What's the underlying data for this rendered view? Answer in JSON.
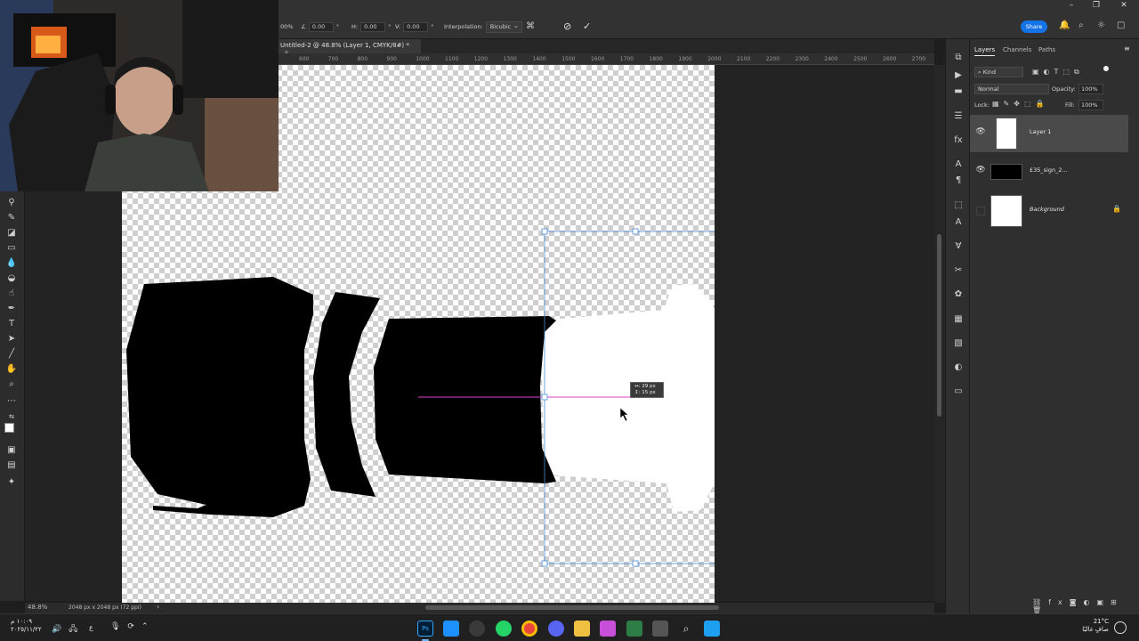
{
  "options_bar": {
    "zoom_fragment": "00%",
    "angle_value": "0.00",
    "angle_unit": "°",
    "h_label": "H:",
    "h_value": "0.00",
    "h_unit": "°",
    "v_label": "V:",
    "v_value": "0.00",
    "v_unit": "°",
    "interpolation_label": "Interpolation:",
    "interpolation_value": "Bicubic",
    "share_label": "Share"
  },
  "document": {
    "tab_title": "Untitled-2 @ 48.8% (Layer 1, CMYK/8#) *",
    "zoom": "48.8%",
    "dimensions": "2048 px x 2048 px (72 ppi)",
    "ruler_ticks": [
      "600",
      "700",
      "800",
      "900",
      "1000",
      "1100",
      "1200",
      "1300",
      "1400",
      "1500",
      "1600",
      "1700",
      "1800",
      "1900",
      "2000",
      "2100",
      "2200",
      "2300",
      "2400",
      "2500",
      "2600",
      "2700"
    ],
    "measure_w": "↔: 29 px",
    "measure_h": "↕: 15 px"
  },
  "panels": {
    "tabs": [
      "Layers",
      "Channels",
      "Paths"
    ],
    "filter_kind": "Kind",
    "blend_mode": "Normal",
    "opacity_label": "Opacity:",
    "opacity_value": "100%",
    "lock_label": "Lock:",
    "fill_label": "Fill:",
    "fill_value": "100%",
    "layers": [
      {
        "name": "Layer 1",
        "visible": true,
        "selected": true
      },
      {
        "name": "£35_sign_2...",
        "visible": true,
        "selected": false
      },
      {
        "name": "Background",
        "visible": false,
        "selected": false,
        "locked": true
      }
    ]
  },
  "taskbar": {
    "time": "١٠:٠٩ م",
    "date": "٢٠٢٥/١١/٢٢",
    "lang": "ع",
    "weather_temp": "21°C",
    "weather_desc": "صافٍ غالبًا"
  },
  "colors": {
    "accent": "#1473e6",
    "selection": "#4a8cd6",
    "guide": "#e040c8"
  }
}
